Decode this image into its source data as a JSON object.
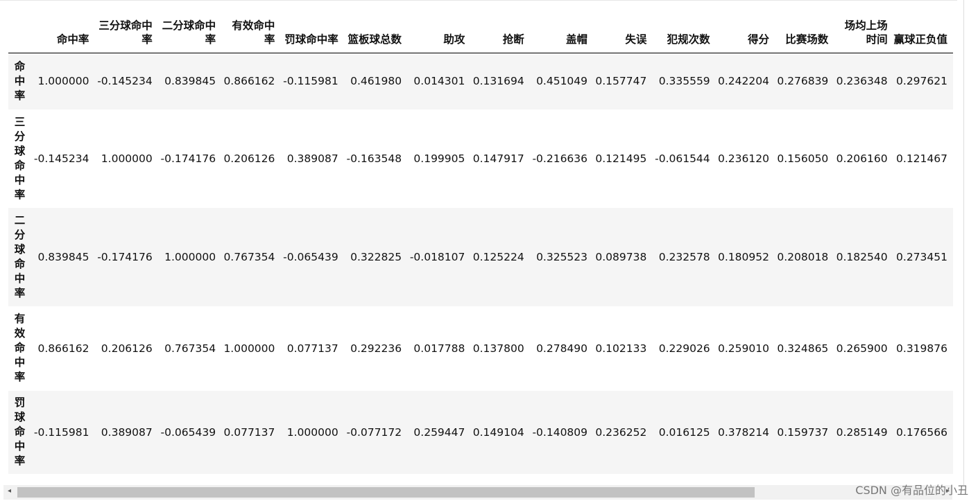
{
  "table": {
    "columns": [
      "命中率",
      "三分球命中率",
      "二分球命中率",
      "有效命中率",
      "罚球命中率",
      "篮板球总数",
      "助攻",
      "抢断",
      "盖帽",
      "失误",
      "犯规次数",
      "得分",
      "比赛场数",
      "场均上场时间",
      "赢球正负值"
    ],
    "rows": [
      {
        "label": "命中率",
        "values": [
          "1.000000",
          "-0.145234",
          "0.839845",
          "0.866162",
          "-0.115981",
          "0.461980",
          "0.014301",
          "0.131694",
          "0.451049",
          "0.157747",
          "0.335559",
          "0.242204",
          "0.276839",
          "0.236348",
          "0.297621"
        ]
      },
      {
        "label": "三分球命中率",
        "values": [
          "-0.145234",
          "1.000000",
          "-0.174176",
          "0.206126",
          "0.389087",
          "-0.163548",
          "0.199905",
          "0.147917",
          "-0.216636",
          "0.121495",
          "-0.061544",
          "0.236120",
          "0.156050",
          "0.206160",
          "0.121467"
        ]
      },
      {
        "label": "二分球命中率",
        "values": [
          "0.839845",
          "-0.174176",
          "1.000000",
          "0.767354",
          "-0.065439",
          "0.322825",
          "-0.018107",
          "0.125224",
          "0.325523",
          "0.089738",
          "0.232578",
          "0.180952",
          "0.208018",
          "0.182540",
          "0.273451"
        ]
      },
      {
        "label": "有效命中率",
        "values": [
          "0.866162",
          "0.206126",
          "0.767354",
          "1.000000",
          "0.077137",
          "0.292236",
          "0.017788",
          "0.137800",
          "0.278490",
          "0.102133",
          "0.229026",
          "0.259010",
          "0.324865",
          "0.265900",
          "0.319876"
        ]
      },
      {
        "label": "罚球命中率",
        "values": [
          "-0.115981",
          "0.389087",
          "-0.065439",
          "0.077137",
          "1.000000",
          "-0.077172",
          "0.259447",
          "0.149104",
          "-0.140809",
          "0.236252",
          "0.016125",
          "0.378214",
          "0.159737",
          "0.285149",
          "0.176566"
        ]
      }
    ]
  },
  "watermark": "CSDN @有品位的小丑",
  "scrollbar": {
    "left_arrow": "◂",
    "right_arrow": "▸"
  }
}
